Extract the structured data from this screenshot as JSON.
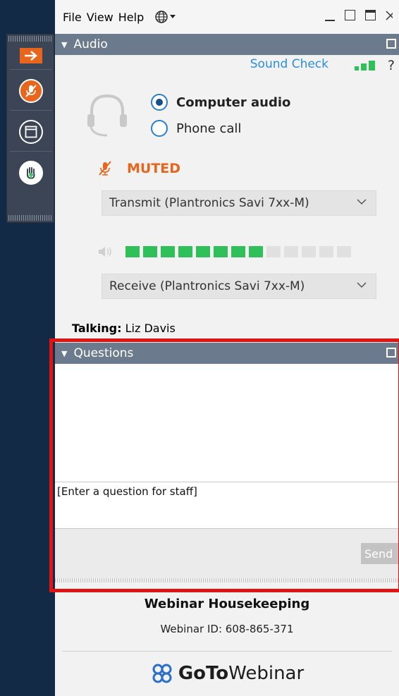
{
  "menu": {
    "file": "File",
    "view": "View",
    "help": "Help"
  },
  "audio": {
    "header": "Audio",
    "sound_check": "Sound Check",
    "help_mark": "?",
    "computer_audio": "Computer audio",
    "phone_call": "Phone call",
    "muted": "MUTED",
    "transmit_device": "Transmit (Plantronics Savi 7xx-M)",
    "receive_device": "Receive (Plantronics Savi 7xx-M)",
    "selected_mode": "computer_audio",
    "level_bars_total": 13,
    "level_bars_active": 8
  },
  "talking": {
    "label": "Talking:",
    "name": "Liz Davis"
  },
  "questions": {
    "header": "Questions",
    "input_value": "[Enter a question for staff]",
    "send_label": "Send"
  },
  "footer": {
    "title": "Webinar Housekeeping",
    "webinar_id": "Webinar ID: 608-865-371",
    "brand_goto": "GoTo",
    "brand_webinar": "Webinar"
  },
  "colors": {
    "accent_orange": "#e8661c",
    "level_green": "#2fc05a",
    "level_off": "#e0e0e0",
    "link_blue": "#2a8fd8",
    "highlight_red": "#e11414"
  }
}
